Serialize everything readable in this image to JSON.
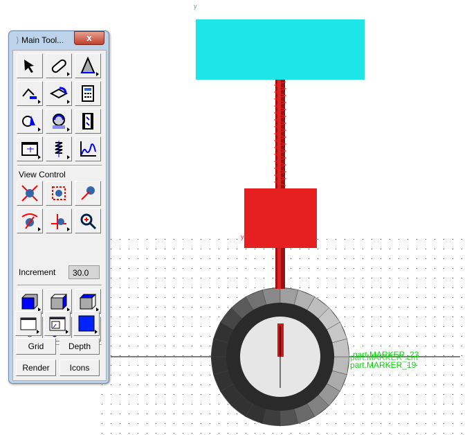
{
  "toolbox": {
    "title": "Main Tool...",
    "close_label": "x",
    "view_control_label": "View Control",
    "increment_label": "Increment",
    "increment_value": "30.0",
    "grid_label": "Grid",
    "depth_label": "Depth",
    "render_label": "Render",
    "icons_label": "Icons"
  },
  "viewport": {
    "markers": [
      "part.MARKER_23",
      "part.MARKER_cm",
      "part.MARKER_19"
    ],
    "colors": {
      "top_block": "#1ee6e6",
      "mass_block": "#e62020",
      "spring": "#e62020",
      "marker_text": "#00dd00"
    }
  }
}
